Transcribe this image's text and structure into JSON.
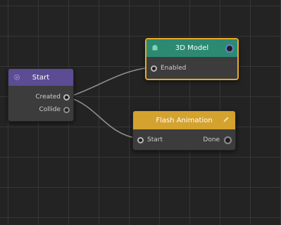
{
  "graph": {
    "nodes": {
      "start": {
        "title": "Start",
        "header_color": "#5b4c93",
        "icon": "gear-icon",
        "outputs": [
          "Created",
          "Collide"
        ]
      },
      "model": {
        "title": "3D Model",
        "header_color": "#2c8a73",
        "icon": "cube-icon",
        "selected": true,
        "inputs": [
          "Enabled"
        ]
      },
      "flash": {
        "title": "Flash Animation",
        "header_color": "#d4a22e",
        "icon": "pencil-icon",
        "inputs": [
          "Start"
        ],
        "outputs": [
          "Done"
        ]
      }
    },
    "connections": [
      {
        "from": "start.Created",
        "to": "model.Enabled"
      },
      {
        "from": "start.Created",
        "to": "flash.Start"
      }
    ],
    "colors": {
      "canvas": "#232323",
      "grid": "#363636",
      "selection": "#e9a92a",
      "wire": "#8e8e8e"
    }
  }
}
